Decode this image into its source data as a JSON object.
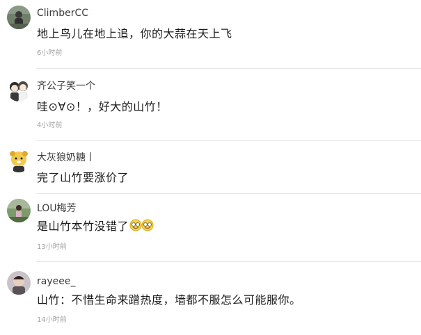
{
  "comments": [
    {
      "username": "ClimberCC",
      "text": "地上鸟儿在地上追，你的大蒜在天上飞",
      "time": "6小时前",
      "avatar": "person-photo-avatar"
    },
    {
      "username": "齐公子笑一个",
      "text": "哇⊙∀⊙！，好大的山竹！",
      "time": "4小时前",
      "avatar": "cartoon-couple-avatar"
    },
    {
      "username": "大灰狼奶糖丨",
      "text": "完了山竹要涨价了",
      "time": "",
      "avatar": "cartoon-dog-avatar"
    },
    {
      "username": "LOU梅芳",
      "text": "是山竹本竹没错了",
      "emoji": "laughing-face-emoji",
      "time": "13小时前",
      "avatar": "outdoor-photo-avatar"
    },
    {
      "username": "rayeee_",
      "text": "山竹：不惜生命来蹭热度，墙都不服怎么可能服你。",
      "time": "14小时前",
      "avatar": "selfie-photo-avatar"
    }
  ]
}
